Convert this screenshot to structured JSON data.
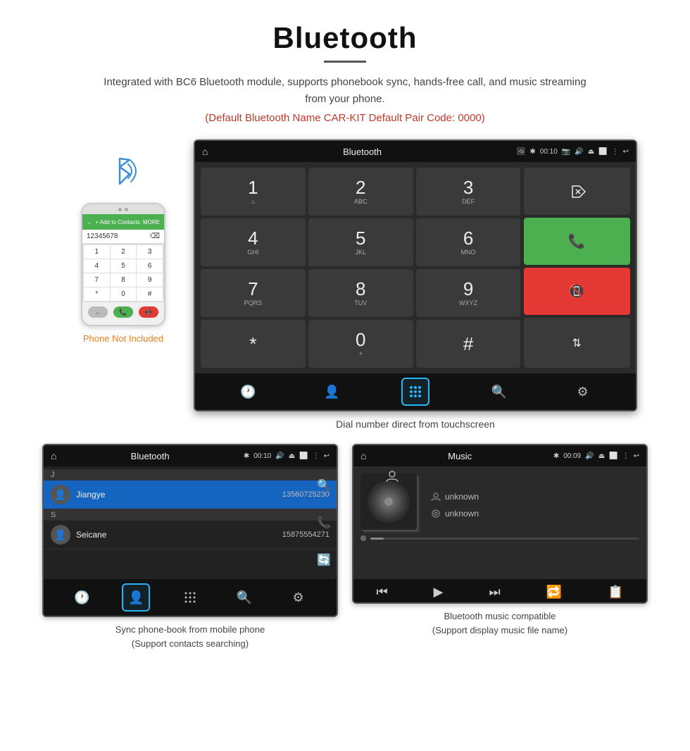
{
  "page": {
    "title": "Bluetooth",
    "title_underline": true,
    "subtitle": "Integrated with BC6 Bluetooth module, supports phonebook sync, hands-free call, and music streaming from your phone.",
    "red_note": "(Default Bluetooth Name CAR-KIT     Default Pair Code: 0000)",
    "phone_not_included": "Phone Not Included",
    "dial_caption": "Dial number direct from touchscreen",
    "contacts_caption_line1": "Sync phone-book from mobile phone",
    "contacts_caption_line2": "(Support contacts searching)",
    "music_caption_line1": "Bluetooth music compatible",
    "music_caption_line2": "(Support display music file name)"
  },
  "status_bar": {
    "bluetooth_title": "Bluetooth",
    "time": "00:10",
    "music_title": "Music",
    "time2": "00:09"
  },
  "dial_keys": [
    {
      "num": "1",
      "sub": ""
    },
    {
      "num": "2",
      "sub": "ABC"
    },
    {
      "num": "3",
      "sub": "DEF"
    },
    {
      "num": "4",
      "sub": "GHI"
    },
    {
      "num": "5",
      "sub": "JKL"
    },
    {
      "num": "6",
      "sub": "MNO"
    },
    {
      "num": "7",
      "sub": "PQRS"
    },
    {
      "num": "8",
      "sub": "TUV"
    },
    {
      "num": "9",
      "sub": "WXYZ"
    },
    {
      "num": "*",
      "sub": ""
    },
    {
      "num": "0",
      "sub": "+"
    },
    {
      "num": "#",
      "sub": ""
    }
  ],
  "contacts": [
    {
      "section": "J",
      "name": "Jiangye",
      "number": "13560725230",
      "active": true
    },
    {
      "section": "S",
      "name": "Seicane",
      "number": "15875554271",
      "active": false
    }
  ],
  "music_info": {
    "track": "unknown",
    "artist": "unknown"
  },
  "phone_keys": [
    "1",
    "2",
    "3",
    "4",
    "5",
    "6",
    "7",
    "8",
    "9",
    "*",
    "0",
    "#"
  ],
  "phone_number": "12345678"
}
